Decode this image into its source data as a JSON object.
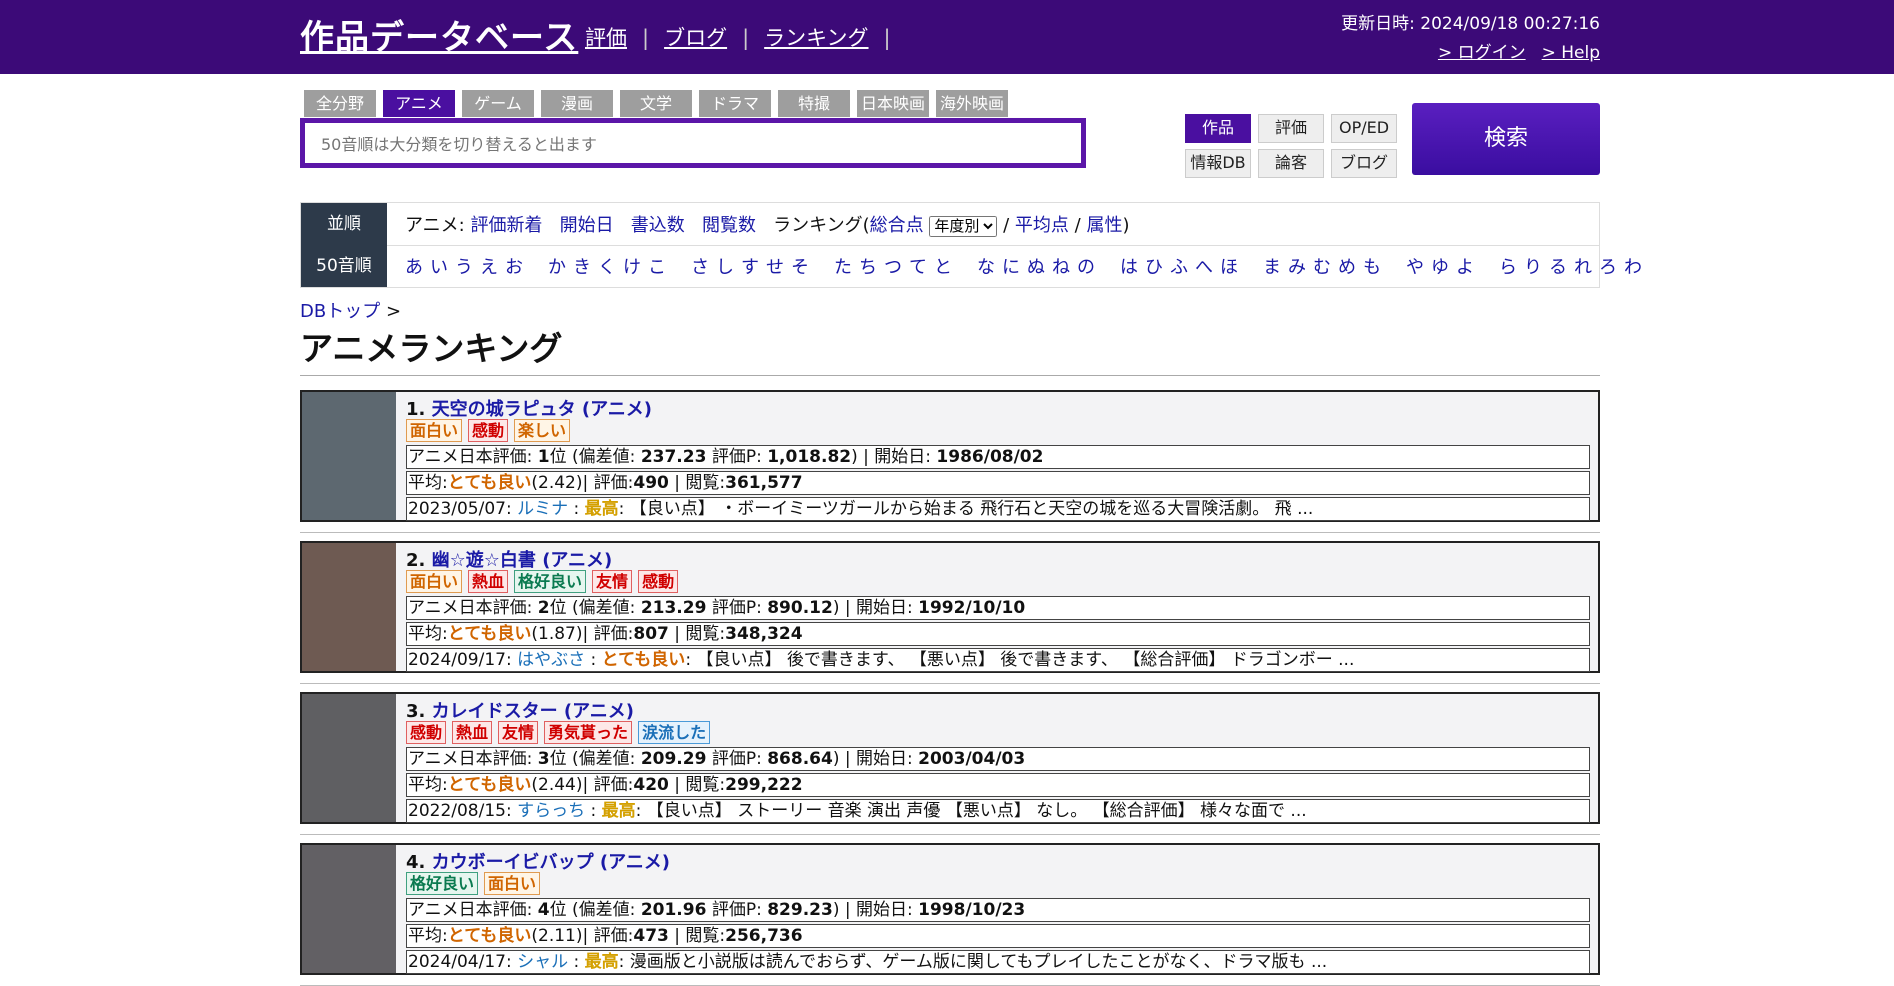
{
  "header": {
    "logo": "作品データベース",
    "nav": [
      "評価",
      "ブログ",
      "ランキング"
    ],
    "updated": "更新日時: 2024/09/18 00:27:16",
    "login": "> ログイン",
    "help": "> Help"
  },
  "category_tabs": [
    "全分野",
    "アニメ",
    "ゲーム",
    "漫画",
    "文学",
    "ドラマ",
    "特撮",
    "日本映画",
    "海外映画"
  ],
  "active_category": "アニメ",
  "search": {
    "placeholder": "50音順は大分類を切り替えると出ます",
    "button": "検索"
  },
  "type_buttons": [
    "作品",
    "評価",
    "OP/ED",
    "情報DB",
    "論客",
    "ブログ"
  ],
  "sort": {
    "label": "並順",
    "prefix": "アニメ:",
    "links": [
      "評価新着",
      "開始日",
      "書込数",
      "閲覧数"
    ],
    "ranking_prefix": "ランキング(",
    "total_link": "総合点",
    "select_value": "年度別",
    "slash1": "/",
    "avg_link": "平均点",
    "slash2": "/",
    "attr_link": "属性",
    "close": ")"
  },
  "kana": {
    "label": "50音順",
    "groups": [
      [
        "あ",
        "い",
        "う",
        "え",
        "お"
      ],
      [
        "か",
        "き",
        "く",
        "け",
        "こ"
      ],
      [
        "さ",
        "し",
        "す",
        "せ",
        "そ"
      ],
      [
        "た",
        "ち",
        "つ",
        "て",
        "と"
      ],
      [
        "な",
        "に",
        "ぬ",
        "ね",
        "の"
      ],
      [
        "は",
        "ひ",
        "ふ",
        "へ",
        "ほ"
      ],
      [
        "ま",
        "み",
        "む",
        "め",
        "も"
      ],
      [
        "や",
        "ゆ",
        "よ"
      ],
      [
        "ら",
        "り",
        "る",
        "れ",
        "ろ",
        "わ"
      ]
    ]
  },
  "breadcrumb": {
    "link": "DBトップ",
    "sep": ">"
  },
  "page_title": "アニメランキング",
  "rankings": [
    {
      "num": "1.",
      "title": "天空の城ラピュタ (アニメ)",
      "tags": [
        {
          "t": "面白い",
          "c": "orange"
        },
        {
          "t": "感動",
          "c": "red"
        },
        {
          "t": "楽しい",
          "c": "orange"
        }
      ],
      "l1": {
        "a": "アニメ日本評価: ",
        "rank": "1",
        "b": "位 (偏差値: ",
        "dev": "237.23",
        "c": " 評価P: ",
        "pts": "1,018.82",
        "d": ") | 開始日: ",
        "date": "1986/08/02"
      },
      "l2": {
        "a": "平均:",
        "eval": "とても良い",
        "b": "(2.42)| 評価:",
        "cnt": "490",
        "c": " | 閲覧:",
        "views": "361,577"
      },
      "l3": {
        "date": "2023/05/07: ",
        "user": "ルミナ",
        "sep": " : ",
        "eval": "最高",
        "evalcls": "best",
        "text": ": 【良い点】 ・ボーイミーツガールから始まる 飛行石と天空の城を巡る大冒険活劇。 飛 ..."
      },
      "thumb": "#5d6870"
    },
    {
      "num": "2.",
      "title": "幽☆遊☆白書 (アニメ)",
      "tags": [
        {
          "t": "面白い",
          "c": "orange"
        },
        {
          "t": "熱血",
          "c": "red"
        },
        {
          "t": "格好良い",
          "c": "green"
        },
        {
          "t": "友情",
          "c": "red"
        },
        {
          "t": "感動",
          "c": "red"
        }
      ],
      "l1": {
        "a": "アニメ日本評価: ",
        "rank": "2",
        "b": "位 (偏差値: ",
        "dev": "213.29",
        "c": " 評価P: ",
        "pts": "890.12",
        "d": ") | 開始日: ",
        "date": "1992/10/10"
      },
      "l2": {
        "a": "平均:",
        "eval": "とても良い",
        "b": "(1.87)| 評価:",
        "cnt": "807",
        "c": " | 閲覧:",
        "views": "348,324"
      },
      "l3": {
        "date": "2024/09/17: ",
        "user": "はやぶさ",
        "sep": " : ",
        "eval": "とても良い",
        "evalcls": "good",
        "text": ": 【良い点】 後で書きます、 【悪い点】 後で書きます、 【総合評価】 ドラゴンボー ..."
      },
      "thumb": "#6e5a52"
    },
    {
      "num": "3.",
      "title": "カレイドスター (アニメ)",
      "tags": [
        {
          "t": "感動",
          "c": "red"
        },
        {
          "t": "熱血",
          "c": "red"
        },
        {
          "t": "友情",
          "c": "red"
        },
        {
          "t": "勇気貰った",
          "c": "red"
        },
        {
          "t": "涙流した",
          "c": "blue"
        }
      ],
      "l1": {
        "a": "アニメ日本評価: ",
        "rank": "3",
        "b": "位 (偏差値: ",
        "dev": "209.29",
        "c": " 評価P: ",
        "pts": "868.64",
        "d": ") | 開始日: ",
        "date": "2003/04/03"
      },
      "l2": {
        "a": "平均:",
        "eval": "とても良い",
        "b": "(2.44)| 評価:",
        "cnt": "420",
        "c": " | 閲覧:",
        "views": "299,222"
      },
      "l3": {
        "date": "2022/08/15: ",
        "user": "すらっち",
        "sep": " : ",
        "eval": "最高",
        "evalcls": "best",
        "text": ": 【良い点】 ストーリー 音楽 演出 声優 【悪い点】 なし。 【総合評価】 様々な面で ..."
      },
      "thumb": "#5f5f62"
    },
    {
      "num": "4.",
      "title": "カウボーイビバップ (アニメ)",
      "tags": [
        {
          "t": "格好良い",
          "c": "green"
        },
        {
          "t": "面白い",
          "c": "orange"
        }
      ],
      "l1": {
        "a": "アニメ日本評価: ",
        "rank": "4",
        "b": "位 (偏差値: ",
        "dev": "201.96",
        "c": " 評価P: ",
        "pts": "829.23",
        "d": ") | 開始日: ",
        "date": "1998/10/23"
      },
      "l2": {
        "a": "平均:",
        "eval": "とても良い",
        "b": "(2.11)| 評価:",
        "cnt": "473",
        "c": " | 閲覧:",
        "views": "256,736"
      },
      "l3": {
        "date": "2024/04/17: ",
        "user": "シャル",
        "sep": " : ",
        "eval": "最高",
        "evalcls": "best",
        "text": ": 漫画版と小説版は読んでおらず、ゲーム版に関してもプレイしたことがなく、ドラマ版も ..."
      },
      "thumb": "#626064"
    }
  ]
}
